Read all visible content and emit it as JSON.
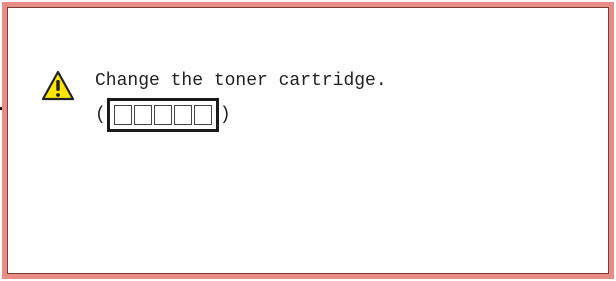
{
  "message": {
    "text": "Change the toner cartridge.",
    "icon": "warning-icon"
  },
  "code": {
    "open_paren": "(",
    "close_paren": ")",
    "placeholder_boxes": 5
  },
  "colors": {
    "panel_border": "#e88d86",
    "warning_fill": "#ffe600",
    "frame": "#1a1a1a"
  }
}
